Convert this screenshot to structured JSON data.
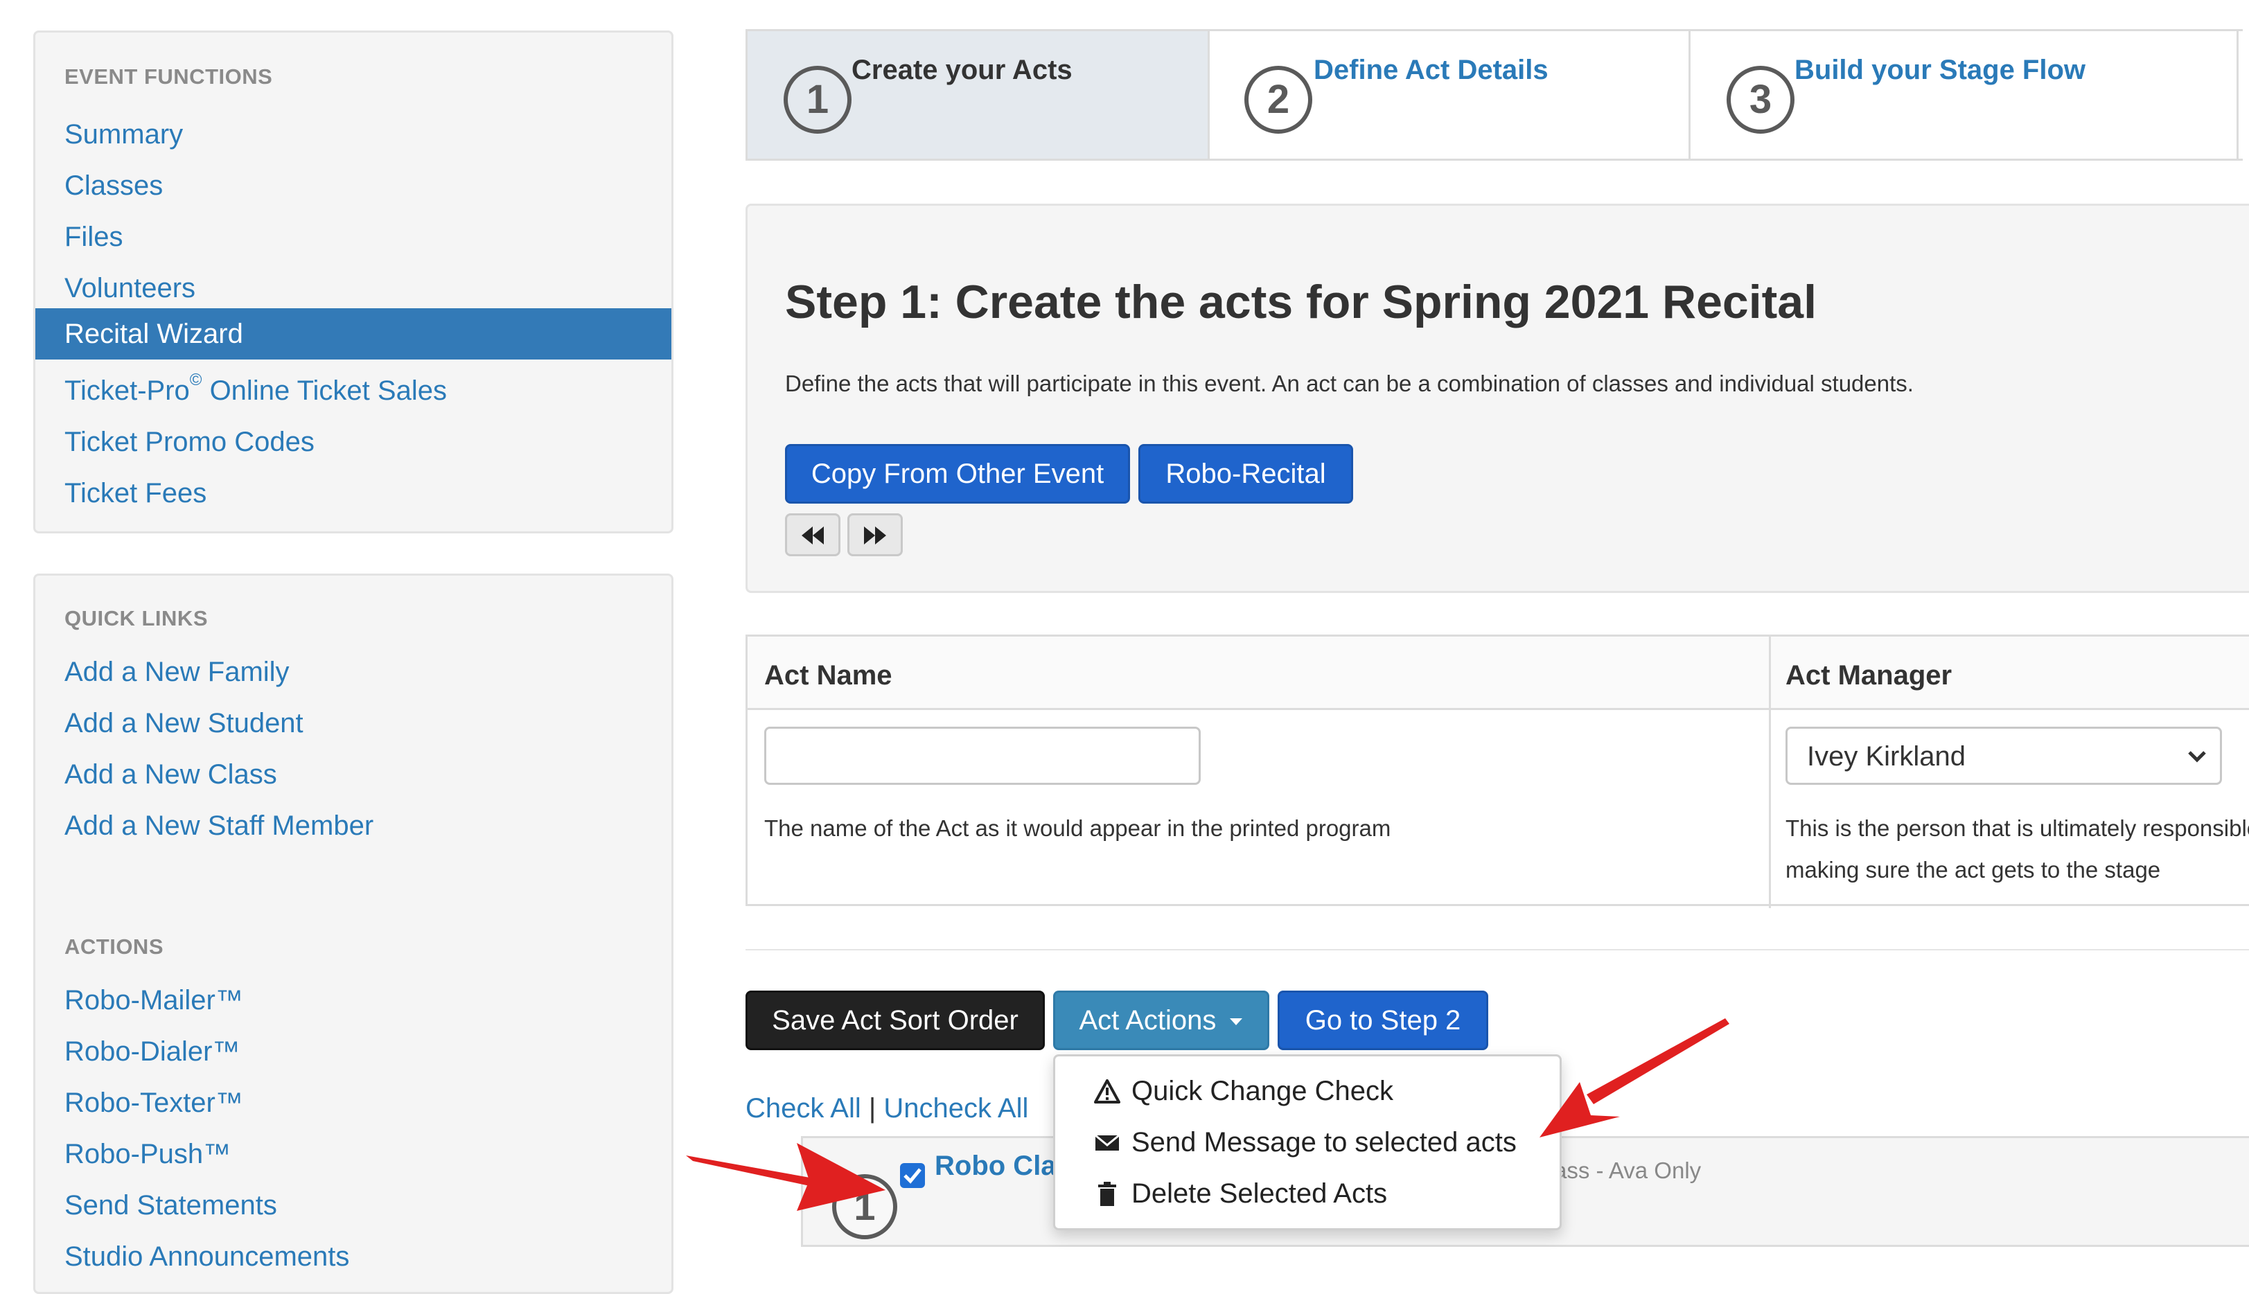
{
  "sidebar": {
    "event_functions": {
      "title": "EVENT FUNCTIONS",
      "items": [
        {
          "label": "Summary"
        },
        {
          "label": "Classes"
        },
        {
          "label": "Files"
        },
        {
          "label": "Volunteers"
        },
        {
          "label": "Recital Wizard",
          "active": true
        },
        {
          "label": "Ticket-Pro",
          "sup": "©",
          "rest": " Online Ticket Sales"
        },
        {
          "label": "Ticket Promo Codes"
        },
        {
          "label": "Ticket Fees"
        }
      ]
    },
    "quick_links": {
      "title": "QUICK LINKS",
      "items": [
        {
          "label": "Add a New Family"
        },
        {
          "label": "Add a New Student"
        },
        {
          "label": "Add a New Class"
        },
        {
          "label": "Add a New Staff Member"
        }
      ]
    },
    "actions": {
      "title": "ACTIONS",
      "items": [
        {
          "label": "Robo-Mailer™"
        },
        {
          "label": "Robo-Dialer™"
        },
        {
          "label": "Robo-Texter™"
        },
        {
          "label": "Robo-Push™"
        },
        {
          "label": "Send Statements"
        },
        {
          "label": "Studio Announcements"
        }
      ]
    }
  },
  "wizard": {
    "steps": [
      {
        "number": "1",
        "label": "Create your Acts",
        "current": true
      },
      {
        "number": "2",
        "label": "Define Act Details"
      },
      {
        "number": "3",
        "label": "Build your Stage Flow"
      }
    ]
  },
  "step_panel": {
    "heading": "Step 1: Create the acts for Spring 2021 Recital",
    "description": "Define the acts that will participate in this event. An act can be a combination of classes and individual students.",
    "copy_button": "Copy From Other Event",
    "robo_button": "Robo-Recital"
  },
  "form_table": {
    "col_act_name": "Act Name",
    "col_act_manager": "Act Manager",
    "act_name_value": "",
    "act_name_help": "The name of the Act as it would appear in the printed program",
    "manager_selected": "Ivey Kirkland",
    "manager_help_line1": "This is the person that is ultimately responsible for",
    "manager_help_line2": "making sure the act gets to the stage"
  },
  "toolbar": {
    "save_order": "Save Act Sort Order",
    "act_actions": "Act Actions",
    "go_step2": "Go to Step 2"
  },
  "dropdown": {
    "items": [
      {
        "label": "Quick Change Check",
        "icon": "warning-icon"
      },
      {
        "label": "Send Message to selected acts",
        "icon": "envelope-icon"
      },
      {
        "label": "Delete Selected Acts",
        "icon": "trash-icon"
      }
    ]
  },
  "check_links": {
    "check_all": "Check All",
    "separator": "|",
    "uncheck_all": "Uncheck All"
  },
  "act_row": {
    "checked": true,
    "name_visible": "Robo Cla",
    "detail_visible": "ass - Ava Only",
    "badge_number": "1"
  },
  "colors": {
    "link": "#2a7ab8",
    "active": "#337ab7",
    "primary_button": "#1f64cc",
    "annotation_arrow": "#e02020"
  }
}
